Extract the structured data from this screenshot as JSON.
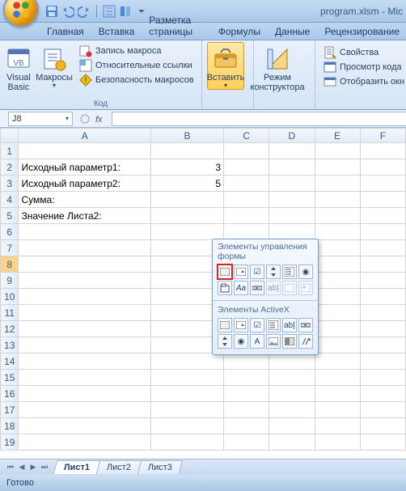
{
  "window": {
    "title": "program.xlsm - Mic"
  },
  "tabs": {
    "home": "Главная",
    "insert": "Вставка",
    "page_layout": "Разметка страницы",
    "formulas": "Формулы",
    "data": "Данные",
    "review": "Рецензирование"
  },
  "ribbon": {
    "code_group": {
      "visual_basic": "Visual\nBasic",
      "macros": "Макросы",
      "record_macro": "Запись макроса",
      "relative_refs": "Относительные ссылки",
      "macro_security": "Безопасность макросов",
      "title": "Код"
    },
    "controls_group": {
      "insert": "Вставить",
      "design_mode": "Режим\nконструктора"
    },
    "props_group": {
      "properties": "Свойства",
      "view_code": "Просмотр кода",
      "show_dialog": "Отобразить окн"
    }
  },
  "dropdown": {
    "form_title": "Элементы управления формы",
    "activex_title": "Элементы ActiveX"
  },
  "formula_bar": {
    "name_box": "J8",
    "fx_value": ""
  },
  "columns": [
    "A",
    "B",
    "C",
    "D",
    "E",
    "F"
  ],
  "rows": [
    1,
    2,
    3,
    4,
    5,
    6,
    7,
    8,
    9,
    10,
    11,
    12,
    13,
    14,
    15,
    16,
    17,
    18,
    19
  ],
  "cells": {
    "A2": "Исходный параметр1:",
    "B2": "3",
    "A3": "Исходный параметр2:",
    "B3": "5",
    "A4": "Сумма:",
    "A5": "Значение Листа2:"
  },
  "active_cell": {
    "row": 8
  },
  "sheet_tabs": {
    "s1": "Лист1",
    "s2": "Лист2",
    "s3": "Лист3"
  },
  "status": "Готово"
}
